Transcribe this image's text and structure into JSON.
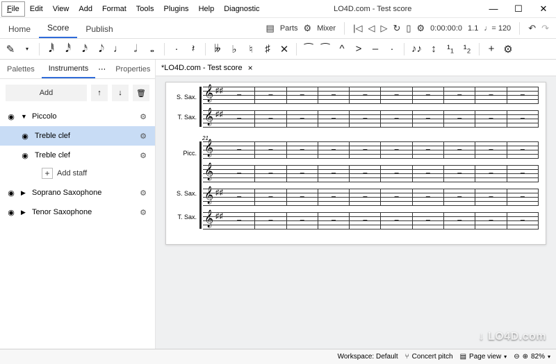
{
  "window": {
    "title": "LO4D.com - Test score"
  },
  "menu": [
    "File",
    "Edit",
    "View",
    "Add",
    "Format",
    "Tools",
    "Plugins",
    "Help",
    "Diagnostic"
  ],
  "window_controls": {
    "min": "—",
    "max": "☐",
    "close": "✕"
  },
  "ribbon_tabs": {
    "home": "Home",
    "score": "Score",
    "publish": "Publish",
    "active": "score"
  },
  "ribbon_right": {
    "parts": "Parts",
    "mixer": "Mixer",
    "time": "0:00:00:0",
    "position": "1.1",
    "tempo": "♩= 120"
  },
  "toolbar_icons": {
    "pencil": "✎",
    "dur64": "𝅘𝅥𝅱",
    "dur32": "𝅘𝅥𝅰",
    "dur16": "𝅘𝅥𝅯",
    "dur8": "𝅘𝅥𝅮",
    "durQ": "♩",
    "durH": "𝅗𝅥",
    "durW": "𝅝",
    "dot": "·",
    "rest": "𝄽",
    "dflat": "𝄫",
    "flat": "♭",
    "nat": "♮",
    "sharp": "♯",
    "x": "✕",
    "tie": "⁀",
    "slur": "⁀",
    "marc": "^",
    "accent": ">",
    "ten": "–",
    "stacc": "·",
    "beam1": "⁀",
    "beam2": "⁀",
    "v1": "¹₁",
    "v2": "¹₂",
    "plus": "+",
    "gear": "⚙"
  },
  "sidebar": {
    "tabs": {
      "palettes": "Palettes",
      "instruments": "Instruments",
      "properties": "Properties"
    },
    "add_btn": "Add",
    "tree": {
      "piccolo": "Piccolo",
      "treble1": "Treble clef",
      "treble2": "Treble clef",
      "add_staff": "Add staff",
      "soprano_sax": "Soprano Saxophone",
      "tenor_sax": "Tenor Saxophone"
    }
  },
  "doc_tab": {
    "label": "*LO4D.com - Test score"
  },
  "score": {
    "system1": {
      "labels": [
        "S. Sax.",
        "T. Sax."
      ],
      "measures": 10
    },
    "system2": {
      "start_measure": "21",
      "labels": [
        "Picc.",
        "",
        "S. Sax.",
        "T. Sax."
      ],
      "measures": 10
    }
  },
  "statusbar": {
    "workspace": "Workspace: Default",
    "concert": "Concert pitch",
    "pageview": "Page view",
    "zoom": "82%"
  },
  "watermark": "↓ LO4D.com"
}
